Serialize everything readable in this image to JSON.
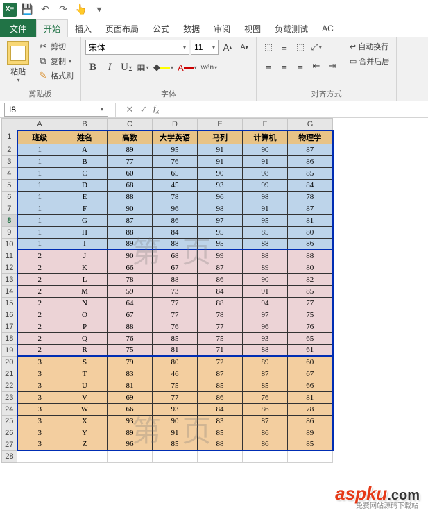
{
  "qat": {
    "save": "💾",
    "undo": "↶",
    "redo": "↷",
    "touch": "☝",
    "more": "▾"
  },
  "tabs": {
    "file": "文件",
    "home": "开始",
    "insert": "插入",
    "layout": "页面布局",
    "formula": "公式",
    "data": "数据",
    "review": "审阅",
    "view": "视图",
    "loadtest": "负载测试",
    "ac": "AC"
  },
  "ribbon": {
    "clipboard": {
      "paste": "粘贴",
      "cut": "剪切",
      "copy": "复制",
      "fmt": "格式刷",
      "group": "剪贴板"
    },
    "font": {
      "name": "宋体",
      "size": "11",
      "grow": "A▴",
      "shrink": "A▾",
      "group": "字体",
      "phonetic": "wén"
    },
    "align": {
      "wrap": "自动换行",
      "merge": "合并后居",
      "group": "对齐方式"
    }
  },
  "namebox": "I8",
  "columns": [
    "A",
    "B",
    "C",
    "D",
    "E",
    "F",
    "G"
  ],
  "headers": [
    "班级",
    "姓名",
    "高数",
    "大学英语",
    "马列",
    "计算机",
    "物理学"
  ],
  "rows": [
    {
      "g": 1,
      "c": [
        "1",
        "A",
        "89",
        "95",
        "91",
        "90",
        "87"
      ]
    },
    {
      "g": 1,
      "c": [
        "1",
        "B",
        "77",
        "76",
        "91",
        "91",
        "86"
      ]
    },
    {
      "g": 1,
      "c": [
        "1",
        "C",
        "60",
        "65",
        "90",
        "98",
        "85"
      ]
    },
    {
      "g": 1,
      "c": [
        "1",
        "D",
        "68",
        "45",
        "93",
        "99",
        "84"
      ]
    },
    {
      "g": 1,
      "c": [
        "1",
        "E",
        "88",
        "78",
        "96",
        "98",
        "78"
      ]
    },
    {
      "g": 1,
      "c": [
        "1",
        "F",
        "90",
        "96",
        "98",
        "91",
        "87"
      ]
    },
    {
      "g": 1,
      "c": [
        "1",
        "G",
        "87",
        "86",
        "97",
        "95",
        "81"
      ]
    },
    {
      "g": 1,
      "c": [
        "1",
        "H",
        "88",
        "84",
        "95",
        "85",
        "80"
      ]
    },
    {
      "g": 1,
      "c": [
        "1",
        "I",
        "89",
        "88",
        "95",
        "88",
        "86"
      ]
    },
    {
      "g": 2,
      "c": [
        "2",
        "J",
        "90",
        "68",
        "99",
        "88",
        "88"
      ]
    },
    {
      "g": 2,
      "c": [
        "2",
        "K",
        "66",
        "67",
        "87",
        "89",
        "80"
      ]
    },
    {
      "g": 2,
      "c": [
        "2",
        "L",
        "78",
        "88",
        "86",
        "90",
        "82"
      ]
    },
    {
      "g": 2,
      "c": [
        "2",
        "M",
        "59",
        "73",
        "84",
        "91",
        "85"
      ]
    },
    {
      "g": 2,
      "c": [
        "2",
        "N",
        "64",
        "77",
        "88",
        "94",
        "77"
      ]
    },
    {
      "g": 2,
      "c": [
        "2",
        "O",
        "67",
        "77",
        "78",
        "97",
        "75"
      ]
    },
    {
      "g": 2,
      "c": [
        "2",
        "P",
        "88",
        "76",
        "77",
        "96",
        "76"
      ]
    },
    {
      "g": 2,
      "c": [
        "2",
        "Q",
        "76",
        "85",
        "75",
        "93",
        "65"
      ]
    },
    {
      "g": 2,
      "c": [
        "2",
        "R",
        "75",
        "81",
        "71",
        "88",
        "61"
      ]
    },
    {
      "g": 3,
      "c": [
        "3",
        "S",
        "79",
        "80",
        "72",
        "89",
        "60"
      ]
    },
    {
      "g": 3,
      "c": [
        "3",
        "T",
        "83",
        "46",
        "87",
        "87",
        "67"
      ]
    },
    {
      "g": 3,
      "c": [
        "3",
        "U",
        "81",
        "75",
        "85",
        "85",
        "66"
      ]
    },
    {
      "g": 3,
      "c": [
        "3",
        "V",
        "69",
        "77",
        "86",
        "76",
        "81"
      ]
    },
    {
      "g": 3,
      "c": [
        "3",
        "W",
        "66",
        "93",
        "84",
        "86",
        "78"
      ]
    },
    {
      "g": 3,
      "c": [
        "3",
        "X",
        "93",
        "90",
        "83",
        "87",
        "86"
      ]
    },
    {
      "g": 3,
      "c": [
        "3",
        "Y",
        "89",
        "91",
        "85",
        "86",
        "89"
      ]
    },
    {
      "g": 3,
      "c": [
        "3",
        "Z",
        "96",
        "85",
        "88",
        "86",
        "85"
      ]
    }
  ],
  "watermarks": {
    "p1": "第     页",
    "p2": "第     页"
  },
  "logo": {
    "text": "aspku",
    "suffix": ".com",
    "sub": "免费网站源码下载站"
  }
}
